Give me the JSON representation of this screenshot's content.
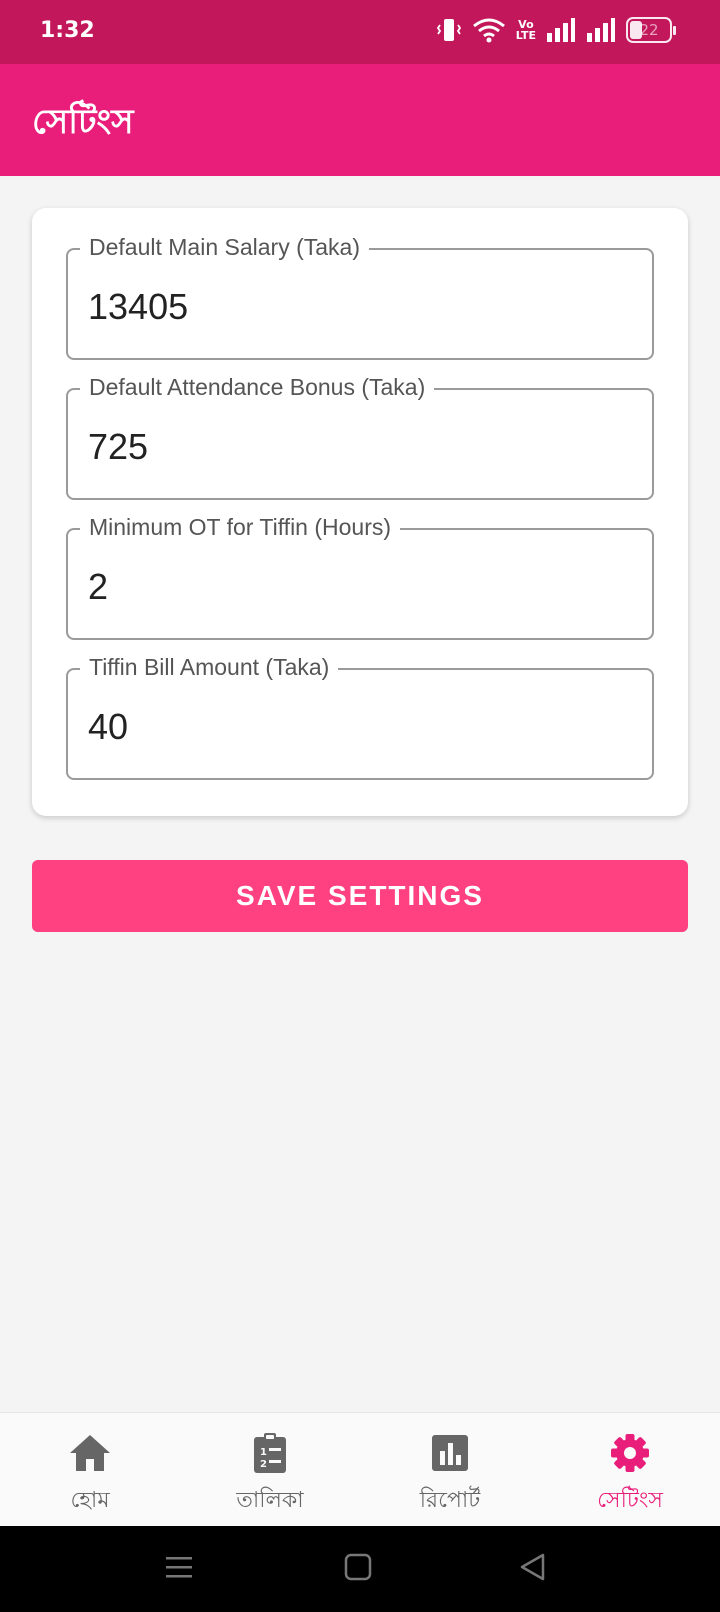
{
  "status_bar": {
    "time": "1:32",
    "network_label_top": "Vo",
    "network_label_bottom": "LTE",
    "battery": "22",
    "icons": [
      "vibrate-icon",
      "wifi-icon",
      "volte-icon",
      "signal-icon",
      "signal-icon",
      "battery-icon"
    ]
  },
  "app_bar": {
    "title": "সেটিংস"
  },
  "settings": {
    "fields": [
      {
        "label": "Default Main Salary (Taka)",
        "value": "13405"
      },
      {
        "label": "Default Attendance Bonus (Taka)",
        "value": "725"
      },
      {
        "label": "Minimum OT for Tiffin (Hours)",
        "value": "2"
      },
      {
        "label": "Tiffin Bill Amount (Taka)",
        "value": "40"
      }
    ],
    "save_label": "SAVE SETTINGS"
  },
  "bottom_nav": {
    "items": [
      {
        "label": "হোম",
        "icon": "home-icon"
      },
      {
        "label": "তালিকা",
        "icon": "clipboard-list-icon"
      },
      {
        "label": "রিপোর্ট",
        "icon": "bar-chart-icon"
      },
      {
        "label": "সেটিংস",
        "icon": "gear-icon",
        "active": true
      }
    ]
  },
  "colors": {
    "status_bar": "#c2185b",
    "app_bar": "#e91e7a",
    "accent": "#ff4081",
    "active_nav": "#e91e7a",
    "inactive_nav": "#666666"
  }
}
